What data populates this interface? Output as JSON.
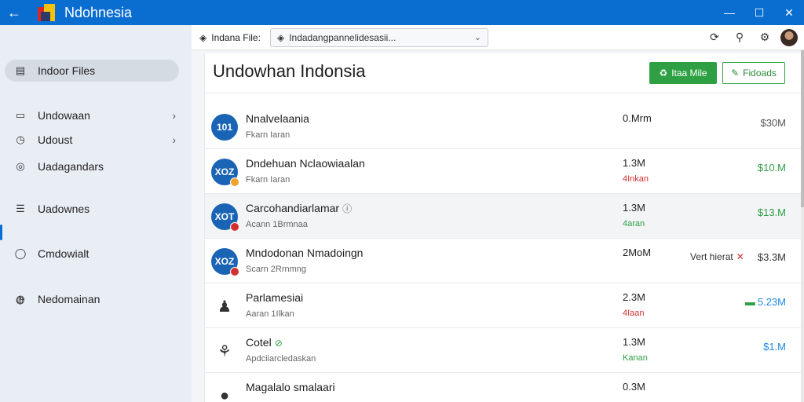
{
  "window": {
    "title": "Ndohnesia",
    "back_icon": "←",
    "minimize": "—",
    "maximize": "☐",
    "close": "✕"
  },
  "sidebar": {
    "items": [
      {
        "label": "Indoor Files",
        "icon": "▤",
        "chevron": "",
        "active": true
      },
      {
        "label": "Undowaan",
        "icon": "▭",
        "chevron": "›"
      },
      {
        "label": "Udoust",
        "icon": "◷",
        "chevron": "›"
      },
      {
        "label": "Uadagandars",
        "icon": "◎",
        "chevron": ""
      },
      {
        "label": "Uadownes",
        "icon": "☰",
        "chevron": ""
      },
      {
        "label": "Cmdowialt",
        "icon": "◯",
        "chevron": ""
      },
      {
        "label": "Nedomainan",
        "icon": "◷",
        "chevron": ""
      }
    ],
    "extra_icon": "◍"
  },
  "toolbar": {
    "crumb": "Indana File:",
    "crumb_icon": "◈",
    "address": "Indadangpannelidesasii...",
    "address_icon": "◈",
    "dropdown_icon": "⌄",
    "refresh_icon": "⟳",
    "share_icon": "⚲",
    "settings_icon": "⚙"
  },
  "main": {
    "title": "Undowhan Indonsia",
    "primary_button": "Itaa Mile",
    "primary_icon": "♻",
    "secondary_button": "Fidoads",
    "secondary_icon": "✎",
    "rows": [
      {
        "thumb": "101",
        "badge": "",
        "name": "Nnalvelaania",
        "extra": "",
        "sub": "Fkarn Iaran",
        "size": "0.Mrm",
        "status": "",
        "status_color": "#666666",
        "note": "",
        "value": "$30M",
        "value_color": "#555555",
        "value_icon": ""
      },
      {
        "thumb": "XOZ",
        "badge": "#f2a12b",
        "name": "Dndehuan Nclaowiaalan",
        "extra": "",
        "sub": "Fkarn Iaran",
        "size": "1.3M",
        "status": "4Inkan",
        "status_color": "#d32f2f",
        "note": "",
        "value": "$10.M",
        "value_color": "#2ea043",
        "value_icon": ""
      },
      {
        "thumb": "XOT",
        "badge": "#d32f2f",
        "name": "Carcohandiarlamar",
        "extra": "ⓘ",
        "extra_green": false,
        "sub": "Acann 1Brmnaa",
        "size": "1.3M",
        "status": "4aran",
        "status_color": "#2ea043",
        "note": "",
        "value": "$13.M",
        "value_color": "#2ea043",
        "value_icon": "",
        "selected": true
      },
      {
        "thumb": "XOZ",
        "badge": "#d32f2f",
        "name": "Mndodonan Nmadoingn",
        "extra": "",
        "sub": "Scarn 2Rrnmng",
        "size": "2MoM",
        "status": "",
        "status_color": "#666666",
        "note": "Vert hierat",
        "note_icon": "✕",
        "value": "$3.3M",
        "value_color": "#333333",
        "value_icon": ""
      },
      {
        "thumb": "♟",
        "plain": true,
        "badge": "",
        "name": "Parlamesiai",
        "extra": "",
        "sub": "Aaran 1Ilkan",
        "size": "2.3M",
        "status": "4Iaan",
        "status_color": "#d32f2f",
        "note": "",
        "value": "5.23M",
        "value_color": "#1e88e5",
        "value_icon": "▬"
      },
      {
        "thumb": "⚘",
        "plain": true,
        "badge": "",
        "name": "Cotel",
        "extra": "⊘",
        "extra_green": true,
        "sub": "Apdciiarcledaskan",
        "size": "1.3M",
        "status": "Kanan",
        "status_color": "#2ea043",
        "note": "",
        "value": "$1.M",
        "value_color": "#1e88e5",
        "value_icon": ""
      },
      {
        "thumb": "●",
        "plain": true,
        "badge": "",
        "name": "Magalalo smalaari",
        "extra": "",
        "sub": "",
        "size": "0.3M",
        "status": "",
        "status_color": "#666666",
        "note": "",
        "value": "",
        "value_color": "#1e88e5",
        "value_icon": ""
      }
    ]
  }
}
